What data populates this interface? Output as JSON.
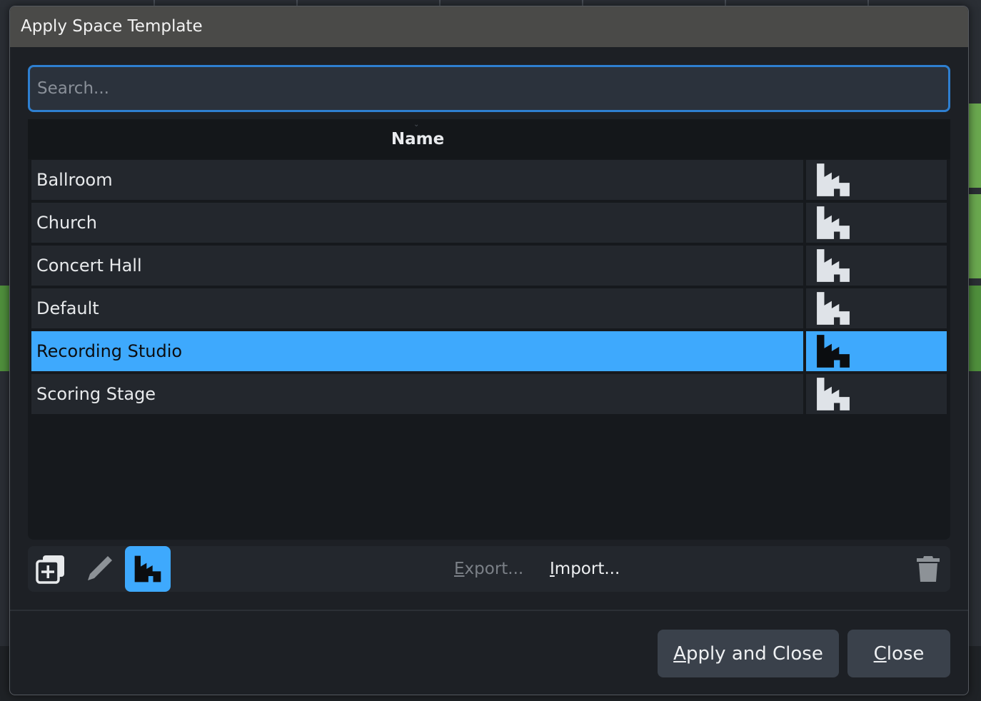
{
  "dialog": {
    "title": "Apply Space Template"
  },
  "search": {
    "placeholder": "Search...",
    "value": ""
  },
  "list": {
    "column_header": "Name",
    "rows": [
      {
        "name": "Ballroom",
        "icon": "factory-icon",
        "selected": false
      },
      {
        "name": "Church",
        "icon": "factory-icon",
        "selected": false
      },
      {
        "name": "Concert Hall",
        "icon": "factory-icon",
        "selected": false
      },
      {
        "name": "Default",
        "icon": "factory-icon",
        "selected": false
      },
      {
        "name": "Recording Studio",
        "icon": "factory-icon",
        "selected": true
      },
      {
        "name": "Scoring Stage",
        "icon": "factory-icon",
        "selected": false
      }
    ]
  },
  "toolbar": {
    "add_icon": "add-copy-icon",
    "edit_icon": "pencil-icon",
    "factory_filter_icon": "factory-icon",
    "export": {
      "mnemonic": "E",
      "rest": "xport...",
      "enabled": false
    },
    "import": {
      "mnemonic": "I",
      "rest": "mport...",
      "enabled": true
    },
    "delete_icon": "trash-icon"
  },
  "footer": {
    "apply_close": {
      "mnemonic": "A",
      "rest": "pply and Close"
    },
    "close": {
      "mnemonic": "C",
      "rest": "lose"
    }
  },
  "colors": {
    "accent": "#3ea9fd",
    "focus_border": "#2e7fd0",
    "titlebar": "#4a4a48",
    "row_bg": "#23272d",
    "button_bg": "#3a414b"
  }
}
